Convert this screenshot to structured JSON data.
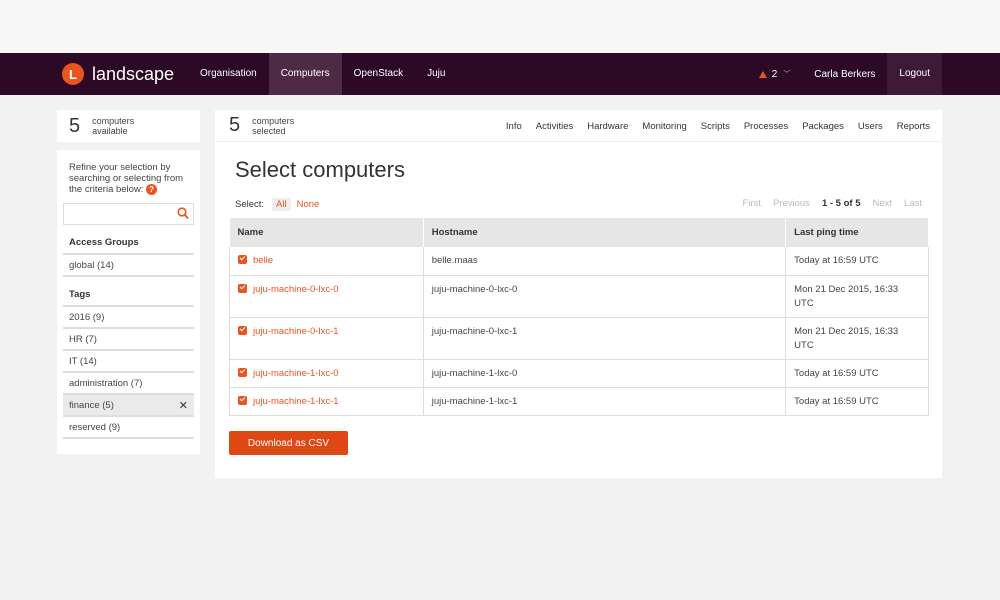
{
  "header": {
    "logo_letter": "L",
    "logo_text": "landscape",
    "nav": [
      {
        "label": "Organisation",
        "active": false
      },
      {
        "label": "Computers",
        "active": true
      },
      {
        "label": "OpenStack",
        "active": false
      },
      {
        "label": "Juju",
        "active": false
      }
    ],
    "alert_count": "2",
    "user_name": "Carla Berkers",
    "logout_label": "Logout"
  },
  "sidebar": {
    "count": "5",
    "count_label_1": "computers",
    "count_label_2": "available",
    "refine_text": "Refine your selection by searching or selecting from the criteria below:",
    "help_glyph": "?",
    "search_value": "",
    "access_groups_title": "Access Groups",
    "access_groups": [
      "global (14)"
    ],
    "tags_title": "Tags",
    "tags": [
      {
        "label": "2016 (9)",
        "selected": false
      },
      {
        "label": "HR (7)",
        "selected": false
      },
      {
        "label": "IT (14)",
        "selected": false
      },
      {
        "label": "administration (7)",
        "selected": false
      },
      {
        "label": "finance (5)",
        "selected": true
      },
      {
        "label": "reserved (9)",
        "selected": false
      }
    ],
    "remove_glyph": "✕"
  },
  "main": {
    "count": "5",
    "count_label_1": "computers",
    "count_label_2": "selected",
    "subnav": [
      "Info",
      "Activities",
      "Hardware",
      "Monitoring",
      "Scripts",
      "Processes",
      "Packages",
      "Users",
      "Reports"
    ],
    "title": "Select computers",
    "select_label": "Select:",
    "select_all": "All",
    "select_none": "None",
    "pager": {
      "first": "First",
      "previous": "Previous",
      "range": "1 - 5 of 5",
      "next": "Next",
      "last": "Last"
    },
    "columns": [
      "Name",
      "Hostname",
      "Last ping time"
    ],
    "rows": [
      {
        "name": "belle",
        "hostname": "belle.maas",
        "ping": "Today at 16:59 UTC"
      },
      {
        "name": "juju-machine-0-lxc-0",
        "hostname": "juju-machine-0-lxc-0",
        "ping": "Mon 21 Dec 2015, 16:33 UTC"
      },
      {
        "name": "juju-machine-0-lxc-1",
        "hostname": "juju-machine-0-lxc-1",
        "ping": "Mon 21 Dec 2015, 16:33 UTC"
      },
      {
        "name": "juju-machine-1-lxc-0",
        "hostname": "juju-machine-1-lxc-0",
        "ping": "Today at 16:59 UTC"
      },
      {
        "name": "juju-machine-1-lxc-1",
        "hostname": "juju-machine-1-lxc-1",
        "ping": "Today at 16:59 UTC"
      }
    ],
    "download_label": "Download as CSV"
  },
  "colors": {
    "accent": "#e95420",
    "header_bg": "#2c0a25",
    "button": "#dd4814"
  }
}
